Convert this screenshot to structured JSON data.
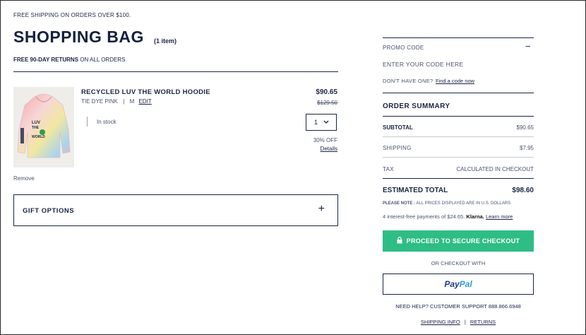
{
  "banner": "FREE SHIPPING ON ORDERS OVER $100.",
  "page_title": "SHOPPING BAG",
  "item_count": "(1 item)",
  "returns_bold": "FREE 90-DAY RETURNS",
  "returns_rest": " ON ALL ORDERS",
  "product": {
    "image_text_1": "LUV",
    "image_text_2": "THE",
    "image_text_3": "WORLD",
    "name": "RECYCLED LUV THE WORLD HOODIE",
    "color": "TIE DYE PINK",
    "sep": "|",
    "size": "M",
    "edit": "EDIT",
    "stock": "In stock",
    "price": "$90.65",
    "old_price": "$129.50",
    "qty": "1",
    "discount": "30% OFF",
    "details": "Details",
    "remove": "Remove"
  },
  "gift_options": "GIFT OPTIONS",
  "gift_plus": "+",
  "promo": {
    "label": "PROMO CODE",
    "toggle": "−",
    "placeholder": "ENTER YOUR CODE HERE",
    "dont_have": "DON'T HAVE ONE?",
    "find_link": "Find a code now"
  },
  "summary": {
    "title": "ORDER SUMMARY",
    "subtotal_label": "SUBTOTAL",
    "subtotal_value": "$90.65",
    "shipping_label": "SHIPPING",
    "shipping_value": "$7.95",
    "tax_label": "TAX",
    "tax_value": "CALCULATED IN CHECKOUT",
    "total_label": "ESTIMATED TOTAL",
    "total_value": "$98.60",
    "note_bold": "PLEASE NOTE :",
    "note_rest": " ALL PRICES DISPLAYED ARE IN U.S. DOLLARS",
    "klarna_text": "4 interest-free payments of $24.65.",
    "klarna_brand": "Klarna.",
    "learn_more": "Learn more"
  },
  "checkout_button": "PROCEED TO SECURE CHECKOUT",
  "or_checkout": "OR CHECKOUT WITH",
  "paypal_1": "Pay",
  "paypal_2": "Pal",
  "support": "NEED HELP? CUSTOMER SUPPORT 888.866.6948",
  "footer": {
    "shipping_info": "SHIPPING INFO",
    "sep": "|",
    "returns": "RETURNS"
  },
  "colors": {
    "navy": "#1b2544",
    "checkout_green": "#2ebd85",
    "paypal_dark": "#1d3a86",
    "paypal_light": "#2a9bd8"
  },
  "icons": [
    "lock-icon",
    "chevron-down-icon",
    "plus-icon",
    "minus-icon"
  ]
}
